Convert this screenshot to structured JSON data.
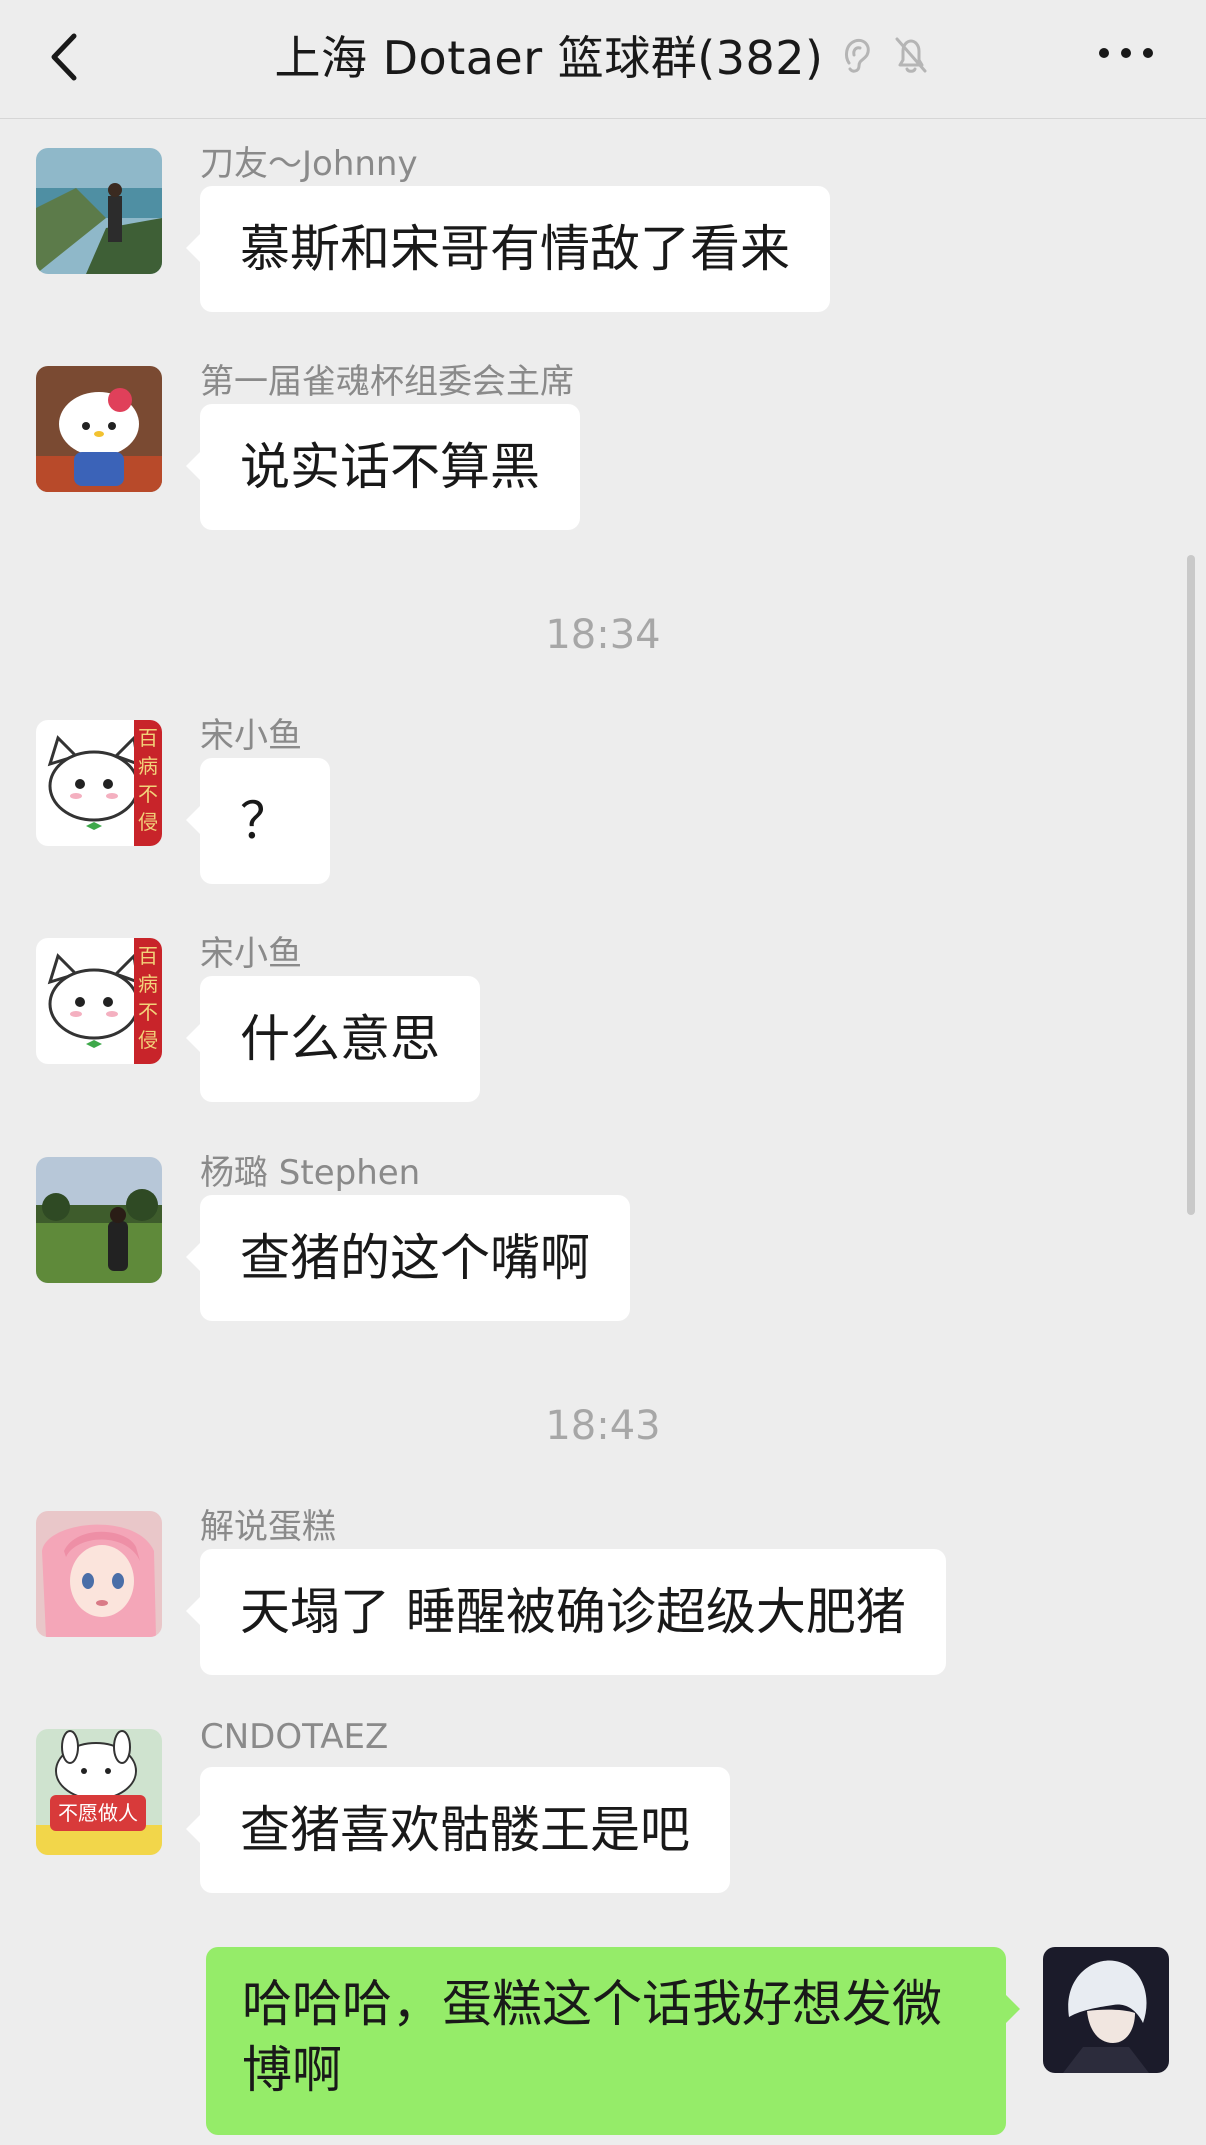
{
  "header": {
    "title": "上海 Dotaer 篮球群(382)"
  },
  "messages": [
    {
      "sender": "刀友～Johnny",
      "text": "慕斯和宋哥有情敌了看来",
      "avatar": "scenic-avatar"
    },
    {
      "sender": "第一届雀魂杯组委会主席",
      "text": "说实话不算黑",
      "avatar": "hello-kitty-avatar"
    },
    {
      "sender": "宋小鱼",
      "text": "？",
      "avatar": "white-cat-avatar"
    },
    {
      "sender": "宋小鱼",
      "text": "什么意思",
      "avatar": "white-cat-avatar"
    },
    {
      "sender": "杨璐 Stephen",
      "text": "查猪的这个嘴啊",
      "avatar": "park-avatar"
    },
    {
      "sender": "解说蛋糕",
      "text": "天塌了 睡醒被确诊超级大肥猪",
      "avatar": "anime-girl-avatar"
    },
    {
      "sender": "CNDOTAEZ",
      "text": "查猪喜欢骷髅王是吧",
      "avatar": "bunny-avatar"
    }
  ],
  "avatar_labels": {
    "cat_sign": "百病不侵",
    "bunny_shirt": "不愿做人"
  },
  "timestamps": [
    "18:34",
    "18:43"
  ],
  "self_message": {
    "text": "哈哈哈，蛋糕这个话我好想发微博啊"
  },
  "colors": {
    "background": "#ededed",
    "bubble_other": "#ffffff",
    "bubble_self": "#95ec69"
  }
}
